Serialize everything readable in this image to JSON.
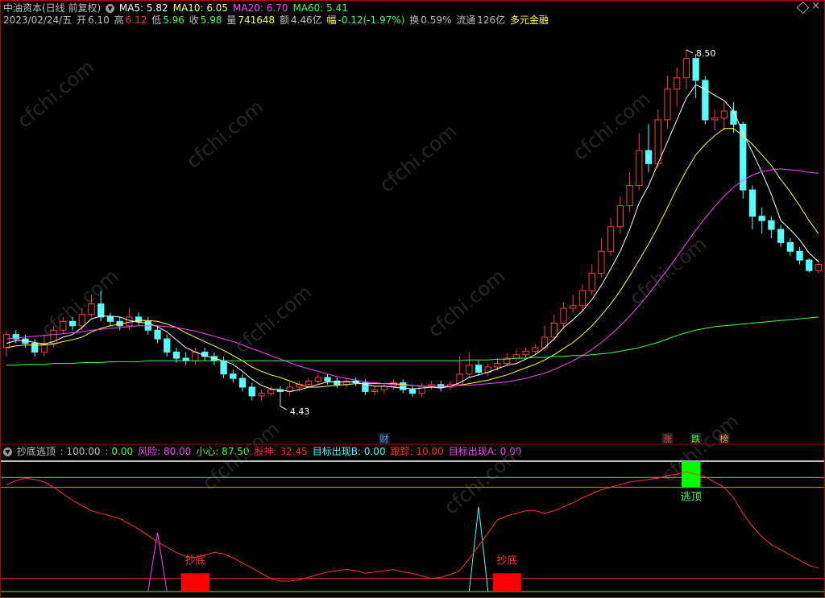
{
  "header": {
    "stock": "中油资本(日线 前复权)",
    "ma": [
      {
        "label": "MA5: 5.82",
        "color": "#ffffff"
      },
      {
        "label": "MA10: 6.05",
        "color": "#ffff40"
      },
      {
        "label": "MA20: 6.70",
        "color": "#ff40ff"
      },
      {
        "label": "MA60: 5.41",
        "color": "#40ff40"
      }
    ],
    "date": "2023/02/24/五",
    "open_label": "开",
    "open": "6.10",
    "high_label": "高",
    "high": "6.12",
    "low_label": "低",
    "low": "5.96",
    "close_label": "收",
    "close": "5.98",
    "vol_label": "量",
    "vol": "741648",
    "amt_label": "额",
    "amt": "4.46亿",
    "chg_label": "幅",
    "chg": "-0.12(-1.97%)",
    "turnover_label": "换",
    "turnover": "0.59%",
    "float_label": "流通",
    "float": "126亿",
    "margin": "多元金融"
  },
  "indicator_header": {
    "name": "抄底逃顶",
    "items": [
      {
        "label": ": 100.00",
        "color": "#c0c0c0"
      },
      {
        "label": ": 0.00",
        "color": "#40ff40"
      },
      {
        "label": "风险: 80.00",
        "color": "#ff40ff"
      },
      {
        "label": "小心: 87.50",
        "color": "#40ff40"
      },
      {
        "label": "股神: 32.45",
        "color": "#ff3030"
      },
      {
        "label": "目标出现B: 0.00",
        "color": "#40ffff"
      },
      {
        "label": "跟踪: 10.00",
        "color": "#ff3030"
      },
      {
        "label": "目标出现A: 0.00",
        "color": "#ff40ff"
      }
    ]
  },
  "annotations": {
    "high_price": "8.50",
    "low_price": "4.43",
    "cai": "财",
    "zhang": "涨",
    "die": "跌",
    "bang": "榜",
    "chaodi": "抄底",
    "taoding": "逃顶",
    "watermark": "cfchi.com"
  },
  "chart_data": [
    {
      "type": "candlestick",
      "title": "中油资本(日线 前复权)",
      "ylim": [
        4.2,
        8.7
      ],
      "candles": [
        [
          5.1,
          5.25,
          5.3,
          5.0
        ],
        [
          5.25,
          5.2,
          5.3,
          5.15
        ],
        [
          5.2,
          5.15,
          5.25,
          5.1
        ],
        [
          5.15,
          5.05,
          5.2,
          5.0
        ],
        [
          5.05,
          5.15,
          5.25,
          5.0
        ],
        [
          5.15,
          5.3,
          5.35,
          5.1
        ],
        [
          5.3,
          5.4,
          5.45,
          5.25
        ],
        [
          5.4,
          5.35,
          5.45,
          5.3
        ],
        [
          5.35,
          5.48,
          5.55,
          5.3
        ],
        [
          5.48,
          5.6,
          5.7,
          5.45
        ],
        [
          5.6,
          5.45,
          5.75,
          5.4
        ],
        [
          5.45,
          5.4,
          5.5,
          5.35
        ],
        [
          5.4,
          5.35,
          5.45,
          5.3
        ],
        [
          5.35,
          5.45,
          5.55,
          5.3
        ],
        [
          5.45,
          5.4,
          5.5,
          5.35
        ],
        [
          5.4,
          5.3,
          5.45,
          5.25
        ],
        [
          5.3,
          5.2,
          5.35,
          5.15
        ],
        [
          5.2,
          5.05,
          5.25,
          5.0
        ],
        [
          5.05,
          4.98,
          5.1,
          4.93
        ],
        [
          4.98,
          4.95,
          5.05,
          4.9
        ],
        [
          4.95,
          5.05,
          5.1,
          4.9
        ],
        [
          5.05,
          5.0,
          5.1,
          4.95
        ],
        [
          5.0,
          4.95,
          5.05,
          4.9
        ],
        [
          4.95,
          4.8,
          5.0,
          4.75
        ],
        [
          4.8,
          4.75,
          4.85,
          4.7
        ],
        [
          4.75,
          4.65,
          4.8,
          4.6
        ],
        [
          4.65,
          4.55,
          4.7,
          4.5
        ],
        [
          4.55,
          4.58,
          4.62,
          4.5
        ],
        [
          4.58,
          4.62,
          4.66,
          4.55
        ],
        [
          4.62,
          4.6,
          4.66,
          4.43
        ],
        [
          4.6,
          4.65,
          4.7,
          4.55
        ],
        [
          4.65,
          4.68,
          4.72,
          4.6
        ],
        [
          4.68,
          4.72,
          4.76,
          4.64
        ],
        [
          4.72,
          4.76,
          4.8,
          4.68
        ],
        [
          4.76,
          4.72,
          4.8,
          4.68
        ],
        [
          4.72,
          4.68,
          4.76,
          4.64
        ],
        [
          4.68,
          4.72,
          4.76,
          4.64
        ],
        [
          4.72,
          4.7,
          4.76,
          4.66
        ],
        [
          4.7,
          4.6,
          4.74,
          4.56
        ],
        [
          4.6,
          4.62,
          4.66,
          4.56
        ],
        [
          4.62,
          4.66,
          4.7,
          4.58
        ],
        [
          4.66,
          4.7,
          4.74,
          4.62
        ],
        [
          4.7,
          4.62,
          4.74,
          4.58
        ],
        [
          4.62,
          4.58,
          4.66,
          4.54
        ],
        [
          4.58,
          4.66,
          4.7,
          4.54
        ],
        [
          4.66,
          4.68,
          4.72,
          4.62
        ],
        [
          4.68,
          4.65,
          4.72,
          4.6
        ],
        [
          4.65,
          4.68,
          4.72,
          4.62
        ],
        [
          4.68,
          4.8,
          5.0,
          4.66
        ],
        [
          4.8,
          4.9,
          5.05,
          4.76
        ],
        [
          4.9,
          4.82,
          4.95,
          4.78
        ],
        [
          4.82,
          4.88,
          4.92,
          4.78
        ],
        [
          4.88,
          4.92,
          4.98,
          4.84
        ],
        [
          4.92,
          4.98,
          5.04,
          4.88
        ],
        [
          4.98,
          5.02,
          5.08,
          4.94
        ],
        [
          5.02,
          5.06,
          5.1,
          4.98
        ],
        [
          5.06,
          5.1,
          5.14,
          5.02
        ],
        [
          5.1,
          5.22,
          5.35,
          5.06
        ],
        [
          5.22,
          5.38,
          5.48,
          5.18
        ],
        [
          5.38,
          5.55,
          5.62,
          5.32
        ],
        [
          5.55,
          5.58,
          5.7,
          5.5
        ],
        [
          5.58,
          5.75,
          5.82,
          5.52
        ],
        [
          5.75,
          5.95,
          6.05,
          5.7
        ],
        [
          5.95,
          6.2,
          6.35,
          5.9
        ],
        [
          6.2,
          6.48,
          6.58,
          6.15
        ],
        [
          6.48,
          6.72,
          6.82,
          6.4
        ],
        [
          6.72,
          6.95,
          7.1,
          6.65
        ],
        [
          6.95,
          7.35,
          7.55,
          6.9
        ],
        [
          7.35,
          7.2,
          7.65,
          7.1
        ],
        [
          7.2,
          7.7,
          7.82,
          7.15
        ],
        [
          7.7,
          8.05,
          8.2,
          7.6
        ],
        [
          8.05,
          8.18,
          8.3,
          7.85
        ],
        [
          8.18,
          8.4,
          8.5,
          8.05
        ],
        [
          8.4,
          8.15,
          8.45,
          7.95
        ],
        [
          8.15,
          7.7,
          8.2,
          7.65
        ],
        [
          7.7,
          7.72,
          7.82,
          7.58
        ],
        [
          7.72,
          7.8,
          7.9,
          7.58
        ],
        [
          7.8,
          7.65,
          7.9,
          7.55
        ],
        [
          7.65,
          6.9,
          7.68,
          6.8
        ],
        [
          6.9,
          6.6,
          6.95,
          6.45
        ],
        [
          6.6,
          6.55,
          6.7,
          6.4
        ],
        [
          6.55,
          6.45,
          6.6,
          6.35
        ],
        [
          6.45,
          6.3,
          6.5,
          6.25
        ],
        [
          6.3,
          6.2,
          6.35,
          6.15
        ],
        [
          6.2,
          6.1,
          6.25,
          6.05
        ],
        [
          6.1,
          5.98,
          6.12,
          5.96
        ],
        [
          5.98,
          6.05,
          6.1,
          5.95
        ]
      ],
      "ma_series": [
        {
          "name": "MA5",
          "color": "#ffffff",
          "values": [
            5.15,
            5.18,
            5.18,
            5.16,
            5.14,
            5.17,
            5.22,
            5.25,
            5.33,
            5.43,
            5.46,
            5.46,
            5.45,
            5.41,
            5.39,
            5.38,
            5.34,
            5.28,
            5.19,
            5.1,
            5.05,
            5.01,
            4.98,
            4.95,
            4.91,
            4.83,
            4.74,
            4.67,
            4.63,
            4.62,
            4.6,
            4.62,
            4.65,
            4.68,
            4.71,
            4.71,
            4.71,
            4.71,
            4.68,
            4.66,
            4.66,
            4.65,
            4.64,
            4.63,
            4.64,
            4.65,
            4.64,
            4.66,
            4.7,
            4.76,
            4.79,
            4.82,
            4.86,
            4.9,
            4.92,
            4.97,
            5.02,
            5.1,
            5.2,
            5.33,
            5.42,
            5.52,
            5.65,
            5.81,
            6.0,
            6.2,
            6.45,
            6.75,
            6.95,
            7.2,
            7.45,
            7.7,
            7.95,
            8.1,
            8.05,
            7.98,
            7.92,
            7.8,
            7.55,
            7.33,
            7.1,
            6.85,
            6.55,
            6.45,
            6.33,
            6.18,
            6.08
          ]
        },
        {
          "name": "MA10",
          "color": "#ffff40",
          "values": [
            5.1,
            5.12,
            5.13,
            5.13,
            5.13,
            5.14,
            5.17,
            5.19,
            5.22,
            5.28,
            5.32,
            5.35,
            5.37,
            5.39,
            5.41,
            5.41,
            5.4,
            5.37,
            5.33,
            5.27,
            5.22,
            5.17,
            5.12,
            5.07,
            5.01,
            4.95,
            4.88,
            4.83,
            4.79,
            4.76,
            4.72,
            4.68,
            4.65,
            4.65,
            4.66,
            4.67,
            4.68,
            4.69,
            4.69,
            4.69,
            4.69,
            4.69,
            4.68,
            4.67,
            4.66,
            4.66,
            4.66,
            4.66,
            4.67,
            4.69,
            4.71,
            4.73,
            4.76,
            4.79,
            4.83,
            4.87,
            4.91,
            4.96,
            5.02,
            5.09,
            5.16,
            5.25,
            5.35,
            5.47,
            5.6,
            5.75,
            5.92,
            6.1,
            6.28,
            6.48,
            6.7,
            6.92,
            7.12,
            7.3,
            7.42,
            7.52,
            7.6,
            7.6,
            7.52,
            7.42,
            7.3,
            7.18,
            7.02,
            6.88,
            6.72,
            6.55,
            6.4
          ]
        },
        {
          "name": "MA20",
          "color": "#ff40ff",
          "values": [
            5.2,
            5.21,
            5.22,
            5.23,
            5.24,
            5.25,
            5.26,
            5.27,
            5.28,
            5.3,
            5.31,
            5.32,
            5.33,
            5.34,
            5.35,
            5.35,
            5.35,
            5.34,
            5.33,
            5.31,
            5.29,
            5.26,
            5.23,
            5.2,
            5.17,
            5.13,
            5.09,
            5.05,
            5.01,
            4.97,
            4.93,
            4.89,
            4.86,
            4.83,
            4.8,
            4.77,
            4.75,
            4.73,
            4.71,
            4.7,
            4.69,
            4.68,
            4.67,
            4.67,
            4.66,
            4.66,
            4.66,
            4.66,
            4.67,
            4.67,
            4.68,
            4.69,
            4.7,
            4.71,
            4.73,
            4.75,
            4.78,
            4.81,
            4.85,
            4.9,
            4.95,
            5.01,
            5.08,
            5.16,
            5.25,
            5.35,
            5.46,
            5.58,
            5.71,
            5.85,
            5.99,
            6.14,
            6.29,
            6.44,
            6.58,
            6.71,
            6.83,
            6.93,
            7.01,
            7.07,
            7.11,
            7.13,
            7.14,
            7.13,
            7.12,
            7.1,
            7.09
          ]
        },
        {
          "name": "MA60",
          "color": "#40ff40",
          "values": [
            4.9,
            4.9,
            4.91,
            4.91,
            4.91,
            4.92,
            4.92,
            4.92,
            4.93,
            4.93,
            4.93,
            4.94,
            4.94,
            4.94,
            4.94,
            4.95,
            4.95,
            4.95,
            4.95,
            4.95,
            4.95,
            4.95,
            4.95,
            4.95,
            4.95,
            4.95,
            4.95,
            4.95,
            4.95,
            4.95,
            4.95,
            4.95,
            4.95,
            4.95,
            4.95,
            4.95,
            4.95,
            4.95,
            4.95,
            4.95,
            4.95,
            4.95,
            4.95,
            4.95,
            4.95,
            4.95,
            4.95,
            4.95,
            4.95,
            4.96,
            4.96,
            4.96,
            4.97,
            4.97,
            4.98,
            4.98,
            4.99,
            4.99,
            5.0,
            5.0,
            5.01,
            5.01,
            5.02,
            5.03,
            5.04,
            5.06,
            5.08,
            5.1,
            5.13,
            5.16,
            5.2,
            5.24,
            5.27,
            5.3,
            5.32,
            5.34,
            5.35,
            5.36,
            5.37,
            5.38,
            5.39,
            5.4,
            5.41,
            5.42,
            5.43,
            5.44,
            5.45
          ]
        }
      ]
    },
    {
      "type": "line",
      "title": "抄底逃顶",
      "ylim": [
        0,
        100
      ],
      "hlines": [
        {
          "value": 100,
          "color": "#c0c0c0"
        },
        {
          "value": 87.5,
          "color": "#40ff40"
        },
        {
          "value": 80,
          "color": "#ff40ff"
        },
        {
          "value": 10,
          "color": "#ff3030"
        },
        {
          "value": 0,
          "color": "#40ff40"
        }
      ],
      "series": [
        {
          "name": "股神",
          "color": "#ff3030",
          "values": [
            82,
            85,
            87,
            86,
            84,
            80,
            75,
            70,
            66,
            62,
            60,
            58,
            56,
            52,
            48,
            43,
            38,
            34,
            30,
            27,
            26,
            28,
            30,
            29,
            26,
            22,
            18,
            14,
            10,
            8,
            8,
            9,
            11,
            13,
            15,
            16,
            17,
            16,
            14,
            15,
            16,
            17,
            15,
            14,
            12,
            10,
            11,
            13,
            16,
            25,
            35,
            45,
            55,
            58,
            60,
            62,
            62,
            60,
            62,
            65,
            68,
            72,
            75,
            78,
            80,
            82,
            84,
            85,
            86,
            87,
            89,
            90,
            92,
            90,
            88,
            84,
            80,
            72,
            60,
            50,
            42,
            36,
            32,
            28,
            24,
            20,
            18
          ]
        }
      ],
      "signals": [
        {
          "label": "抄底",
          "type": "bar",
          "color": "#ff0000",
          "from": 19,
          "to": 21,
          "value": 14
        },
        {
          "label": "抄底",
          "type": "bar",
          "color": "#ff0000",
          "from": 52,
          "to": 54,
          "value": 14
        },
        {
          "label": "逃顶",
          "type": "bar",
          "color": "#00ff00",
          "from": 72,
          "to": 73,
          "value": 100,
          "base": 80
        },
        {
          "label": "",
          "type": "spike",
          "color": "#ff40ff",
          "at": 16,
          "value": 45
        },
        {
          "label": "",
          "type": "spike",
          "color": "#40ffff",
          "at": 50,
          "value": 65
        }
      ]
    }
  ]
}
